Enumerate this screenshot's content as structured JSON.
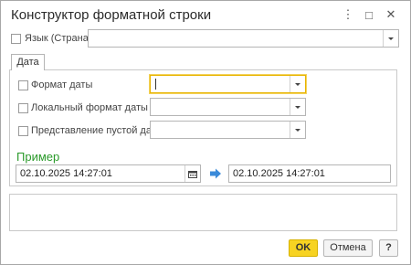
{
  "window": {
    "title": "Конструктор форматной строки",
    "more_icon": "⋮",
    "maximize_icon": "□",
    "close_icon": "✕"
  },
  "language": {
    "label": "Язык (Страна)",
    "value": ""
  },
  "tabs": [
    {
      "label": "Дата"
    }
  ],
  "fields": {
    "date_format": {
      "label": "Формат даты",
      "value": ""
    },
    "local_date_format": {
      "label": "Локальный формат даты",
      "value": ""
    },
    "empty_date": {
      "label": "Представление пустой даты",
      "value": ""
    }
  },
  "example": {
    "heading": "Пример",
    "input_value": "02.10.2025 14:27:01",
    "output_value": "02.10.2025 14:27:01"
  },
  "buttons": {
    "ok": "OK",
    "cancel": "Отмена",
    "help": "?"
  },
  "colors": {
    "accent_yellow": "#f7d322",
    "example_green": "#2a9a2a",
    "arrow_blue": "#3a8ad9"
  }
}
